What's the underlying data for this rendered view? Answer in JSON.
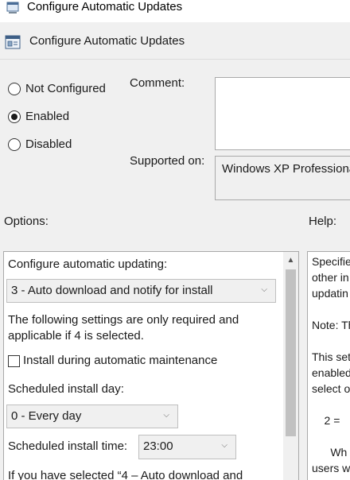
{
  "window": {
    "title": "Configure Automatic Updates",
    "title_icon": "policy-window-icon"
  },
  "header": {
    "title": "Configure Automatic Updates",
    "icon": "policy-setting-icon"
  },
  "state_options": [
    {
      "label": "Not Configured",
      "checked": false
    },
    {
      "label": "Enabled",
      "checked": true
    },
    {
      "label": "Disabled",
      "checked": false
    }
  ],
  "comment": {
    "label": "Comment:",
    "value": ""
  },
  "supported_on": {
    "label": "Supported on:",
    "value": "Windows XP Professional"
  },
  "options": {
    "section_label": "Options:",
    "configure_label": "Configure automatic updating:",
    "configure_value": "3 - Auto download and notify for install",
    "note_line1": "The following settings are only required and",
    "note_line2": "applicable if 4 is selected.",
    "install_maintenance_label": "Install during automatic maintenance",
    "install_maintenance_checked": false,
    "install_day_label": "Scheduled install day:",
    "install_day_value": "0 - Every day",
    "install_time_label": "Scheduled install time:",
    "install_time_value": "23:00",
    "cut_text": "If you have selected “4 – Auto download and"
  },
  "help": {
    "section_label": "Help:",
    "lines": [
      "Specifie",
      "other in",
      "updatin",
      "",
      "Note: Th",
      "",
      "This set",
      "enabled",
      "select o",
      "",
      "    2 =",
      "",
      "      Wh",
      "users w"
    ]
  }
}
